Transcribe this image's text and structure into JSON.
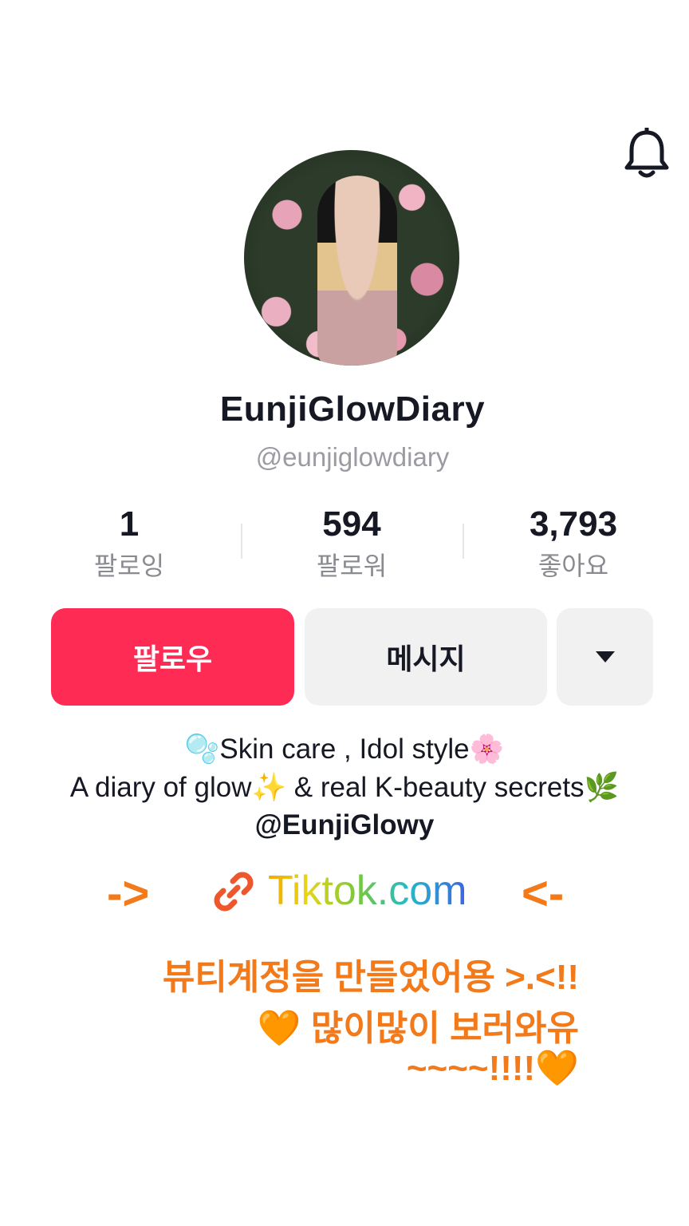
{
  "profile": {
    "display_name": "EunjiGlowDiary",
    "handle": "@eunjiglowdiary"
  },
  "stats": [
    {
      "value": "1",
      "label": "팔로잉"
    },
    {
      "value": "594",
      "label": "팔로워"
    },
    {
      "value": "3,793",
      "label": "좋아요"
    }
  ],
  "actions": {
    "follow_label": "팔로우",
    "message_label": "메시지"
  },
  "bio": {
    "line1": "🫧Skin care , Idol style🌸",
    "line2": "A diary of glow✨ & real K-beauty secrets🌿",
    "line3": "@EunjiGlowy"
  },
  "link": {
    "left_arrow": "->",
    "text": "Tiktok.com",
    "right_arrow": "<-"
  },
  "promo": {
    "line1": "뷰티계정을 만들었어용 >.<!!",
    "line2": "🧡 많이많이 보러와유",
    "line3": "~~~~!!!!🧡"
  },
  "icons": {
    "bell": "bell-icon",
    "dropdown": "triangle-down-icon",
    "link": "link-icon"
  },
  "colors": {
    "follow": "#fe2c55",
    "secondary_button": "#f1f1f2",
    "promo": "#f27a1a"
  }
}
